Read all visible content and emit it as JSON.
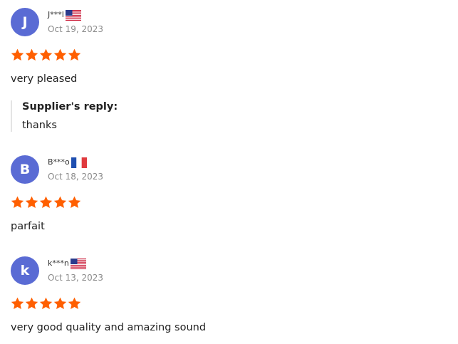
{
  "reviews": [
    {
      "avatar_letter": "J",
      "name": "J***l",
      "country": "US",
      "date": "Oct 19, 2023",
      "rating": 5,
      "text": "very pleased",
      "reply": {
        "title": "Supplier's reply:",
        "text": "thanks"
      }
    },
    {
      "avatar_letter": "B",
      "name": "B***o",
      "country": "FR",
      "date": "Oct 18, 2023",
      "rating": 5,
      "text": "parfait"
    },
    {
      "avatar_letter": "k",
      "name": "k***n",
      "country": "US",
      "date": "Oct 13, 2023",
      "rating": 5,
      "text": "very good quality and amazing sound"
    }
  ],
  "colors": {
    "avatar_bg": "#5a6bd4",
    "star": "#ff5f00",
    "date_text": "#8a8a8a",
    "reply_border": "#e4e4e4"
  },
  "icons": {
    "star": "star-icon",
    "flag_us": "flag-us-icon",
    "flag_fr": "flag-fr-icon"
  }
}
